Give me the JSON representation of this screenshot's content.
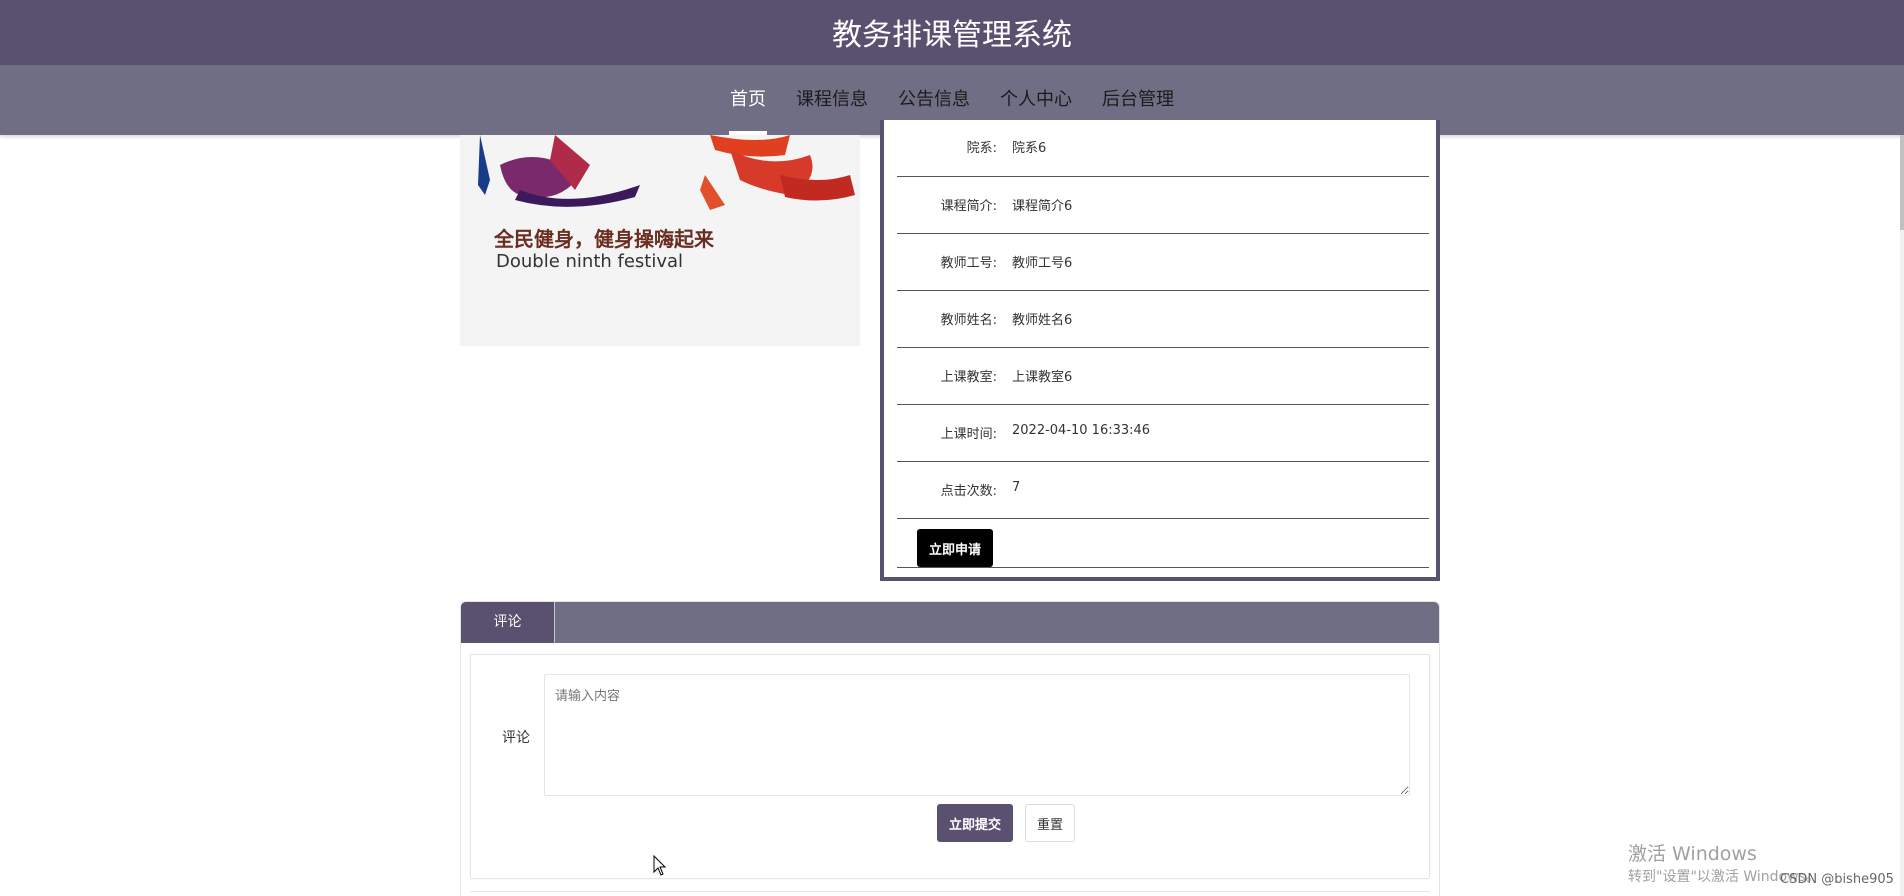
{
  "header": {
    "title": "教务排课管理系统"
  },
  "nav": {
    "items": [
      {
        "label": "首页",
        "active": true
      },
      {
        "label": "课程信息",
        "active": false
      },
      {
        "label": "公告信息",
        "active": false
      },
      {
        "label": "个人中心",
        "active": false
      },
      {
        "label": "后台管理",
        "active": false
      }
    ]
  },
  "poster": {
    "line1": "全民健身，健身操嗨起来",
    "line2": "Double ninth festival"
  },
  "details": {
    "rows": [
      {
        "label": "院系:",
        "value": "院系6"
      },
      {
        "label": "课程简介:",
        "value": "课程简介6"
      },
      {
        "label": "教师工号:",
        "value": "教师工号6"
      },
      {
        "label": "教师姓名:",
        "value": "教师姓名6"
      },
      {
        "label": "上课教室:",
        "value": "上课教室6"
      },
      {
        "label": "上课时间:",
        "value": "2022-04-10 16:33:46"
      },
      {
        "label": "点击次数:",
        "value": "7"
      }
    ],
    "apply_label": "立即申请"
  },
  "comments": {
    "tab_label": "评论",
    "field_label": "评论",
    "placeholder": "请输入内容",
    "submit_label": "立即提交",
    "reset_label": "重置"
  },
  "watermark": {
    "title": "激活 Windows",
    "subtitle": "转到\"设置\"以激活 Windows。",
    "credit": "CSDN @bishe905"
  },
  "colors": {
    "header": "#5a5070",
    "nav": "#6f6e85",
    "accent": "#5a5070"
  }
}
